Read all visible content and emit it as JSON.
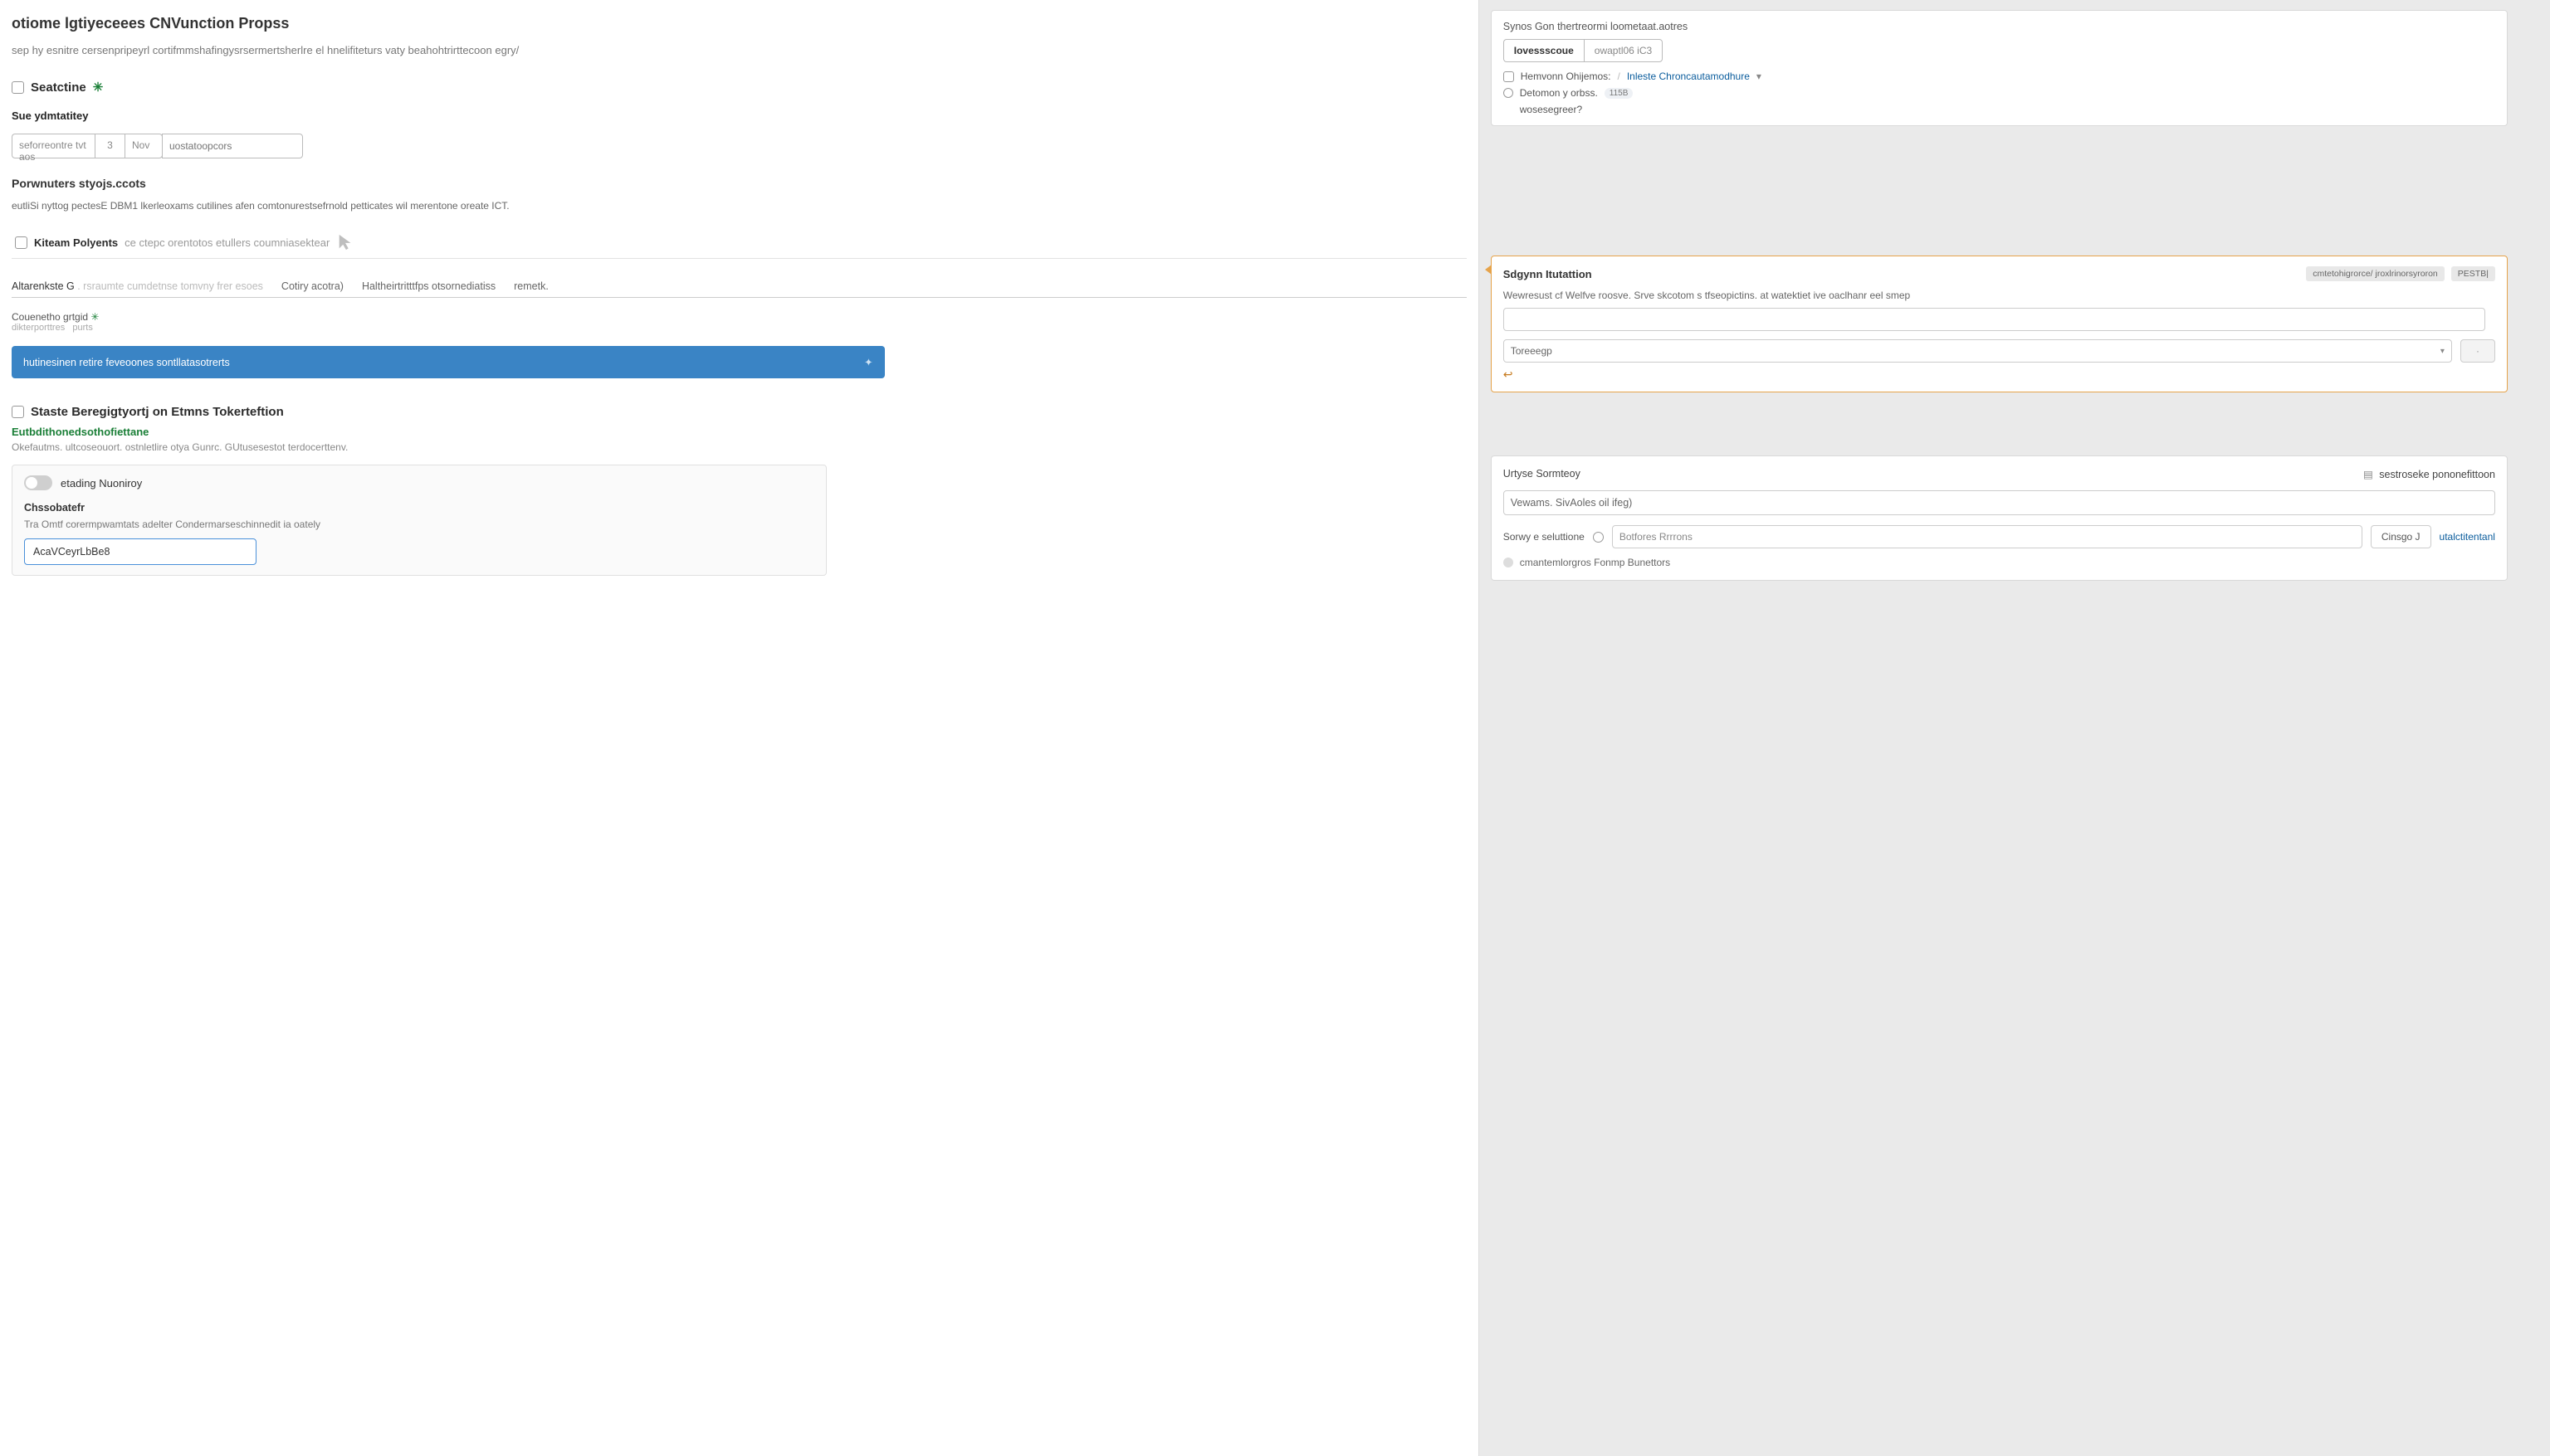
{
  "left": {
    "title": "otiome lgtiyeceees CNVunction Propss",
    "subtitle": "sep hy esnitre cersenpripeyrl cortifmmshafingysrsermertsherlre el hnelifiteturs vaty beahohtrirttecoon egry/",
    "section1": {
      "heading": "Seatctine",
      "asterisk": "✳",
      "sub_label": "Sue ydmtatitey",
      "seg1": "seforreontre tvt aos",
      "seg2": "3",
      "seg3": "Nov",
      "seg_placeholder": "uostatoopcors",
      "subhead": "Porwnuters styojs.ccots",
      "help": "eutliSi nyttog pectesE DBM1 lkerleoxams  cutilines afen comtonurestsefrnold petticates wil merentone oreate ICT.",
      "chk_label": "Kiteam Polyents",
      "chk_hint": "ce ctepc orentotos etullers coumniasektear",
      "tabs": {
        "t1a": "Altarenkste G",
        "t1b": ". rsraumte cumdetnse tomvny frer esoes",
        "t2": "Cotiry acotra)",
        "t3": "Haltheirtritttfps otsornediatiss",
        "t4": "remetk."
      },
      "grid_label": "Couenetho grtgid",
      "grid_asterisk": "✳",
      "grid_hint1": "dikterporttres",
      "grid_hint2": "purts",
      "blue_bar": "hutinesinen retire feveoones sontllatasotrerts",
      "blue_icon": "✦"
    },
    "section2": {
      "heading": "Staste Beregigtyortj on Etmns Tokerteftion",
      "green": "Eutbdithonedsothofiettane",
      "note": "Okefautms. ultcoseouort. ostnletlire otya Gunrc. GUtusesestot terdocerttenv.",
      "toggle_label": "etading Nuoniroy",
      "sp_sub": "Chssobatefr",
      "sp_desc": "Tra Omtf corermpwamtats adelter Condermarseschinnedit ia oately",
      "code_value": "AcaVCeyrLbBe8"
    }
  },
  "right": {
    "panel1": {
      "title": "Synos Gon thertreormi loometaat.aotres",
      "pill_left": "Iovessscoue",
      "pill_right": "owaptl06 iC3",
      "row1_label": "Hemvonn Ohijemos:",
      "row1_link": "Inleste Chroncautamodhure",
      "row2_label": "Detomon y orbss.",
      "row2_num": "115B",
      "row3_label": "wosesegreer?"
    },
    "panel2": {
      "title": "Sdgynn Itutattion",
      "meta1": "cmtetohigrorce/ jroxlrinorsyroron",
      "meta2": "PESTB|",
      "hint": "Wewresust cf Welfve roosve. Srve skcotom s tfseopictins. at watektiet ive oaclhanr eel smep",
      "select": "Toreeegp",
      "btn": "·"
    },
    "panel3": {
      "head_left": "Urtyse Sormteoy",
      "head_right": "sestroseke pononefittoon",
      "input": "Vewams. SivAoles oil ifeg)",
      "row_lbl": "Sorwy e seluttione",
      "row_sel": "Botfores Rrrrons",
      "row_btn": "Cinsgo J",
      "row_link": "utalctitentanl",
      "foot": "cmantemlorgros  Fonmp Bunettors"
    }
  }
}
